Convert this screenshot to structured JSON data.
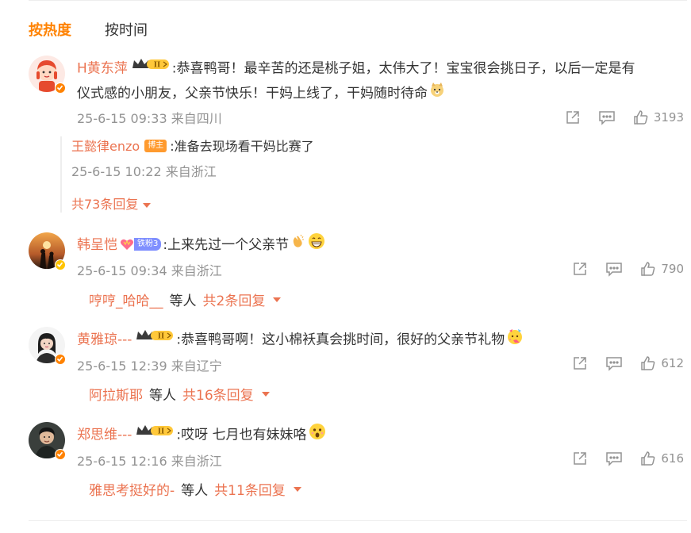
{
  "tabs": {
    "hot": "按热度",
    "time": "按时间"
  },
  "colors": {
    "accent": "#ff8200",
    "username": "#eb7350",
    "meta": "#939393"
  },
  "comments": [
    {
      "user": "H黄东萍",
      "text": ":恭喜鸭哥！最辛苦的还是桃子姐，太伟大了！宝宝很会挑日子，以后一定是有",
      "text2": "仪式感的小朋友，父亲节快乐！干妈上线了，干妈随时待命",
      "time": "25-6-15 09:33",
      "source": "来自四川",
      "likes": "3193",
      "reply": {
        "user": "王懿律enzo",
        "badge": "博主",
        "text": ":准备去现场看干妈比赛了",
        "time": "25-6-15 10:22",
        "source": "来自浙江"
      },
      "more_replies": "共73条回复"
    },
    {
      "user": "韩呈恺",
      "fan_badge": "铁粉3",
      "text": ":上来先过一个父亲节",
      "time": "25-6-15 09:34",
      "source": "来自浙江",
      "likes": "790",
      "sub_user": "哼哼_哈哈__",
      "sub_mid": "等人",
      "sub_count": "共2条回复"
    },
    {
      "user": "黄雅琼---",
      "text": ":恭喜鸭哥啊！这小棉袄真会挑时间，很好的父亲节礼物",
      "time": "25-6-15 12:39",
      "source": "来自辽宁",
      "likes": "612",
      "sub_user": "阿拉斯耶",
      "sub_mid": "等人",
      "sub_count": "共16条回复"
    },
    {
      "user": "郑思维---",
      "text": ":哎呀 七月也有妹妹咯",
      "time": "25-6-15 12:16",
      "source": "来自浙江",
      "likes": "616",
      "sub_user": "雅思考挺好的-",
      "sub_mid": "等人",
      "sub_count": "共11条回复"
    }
  ]
}
